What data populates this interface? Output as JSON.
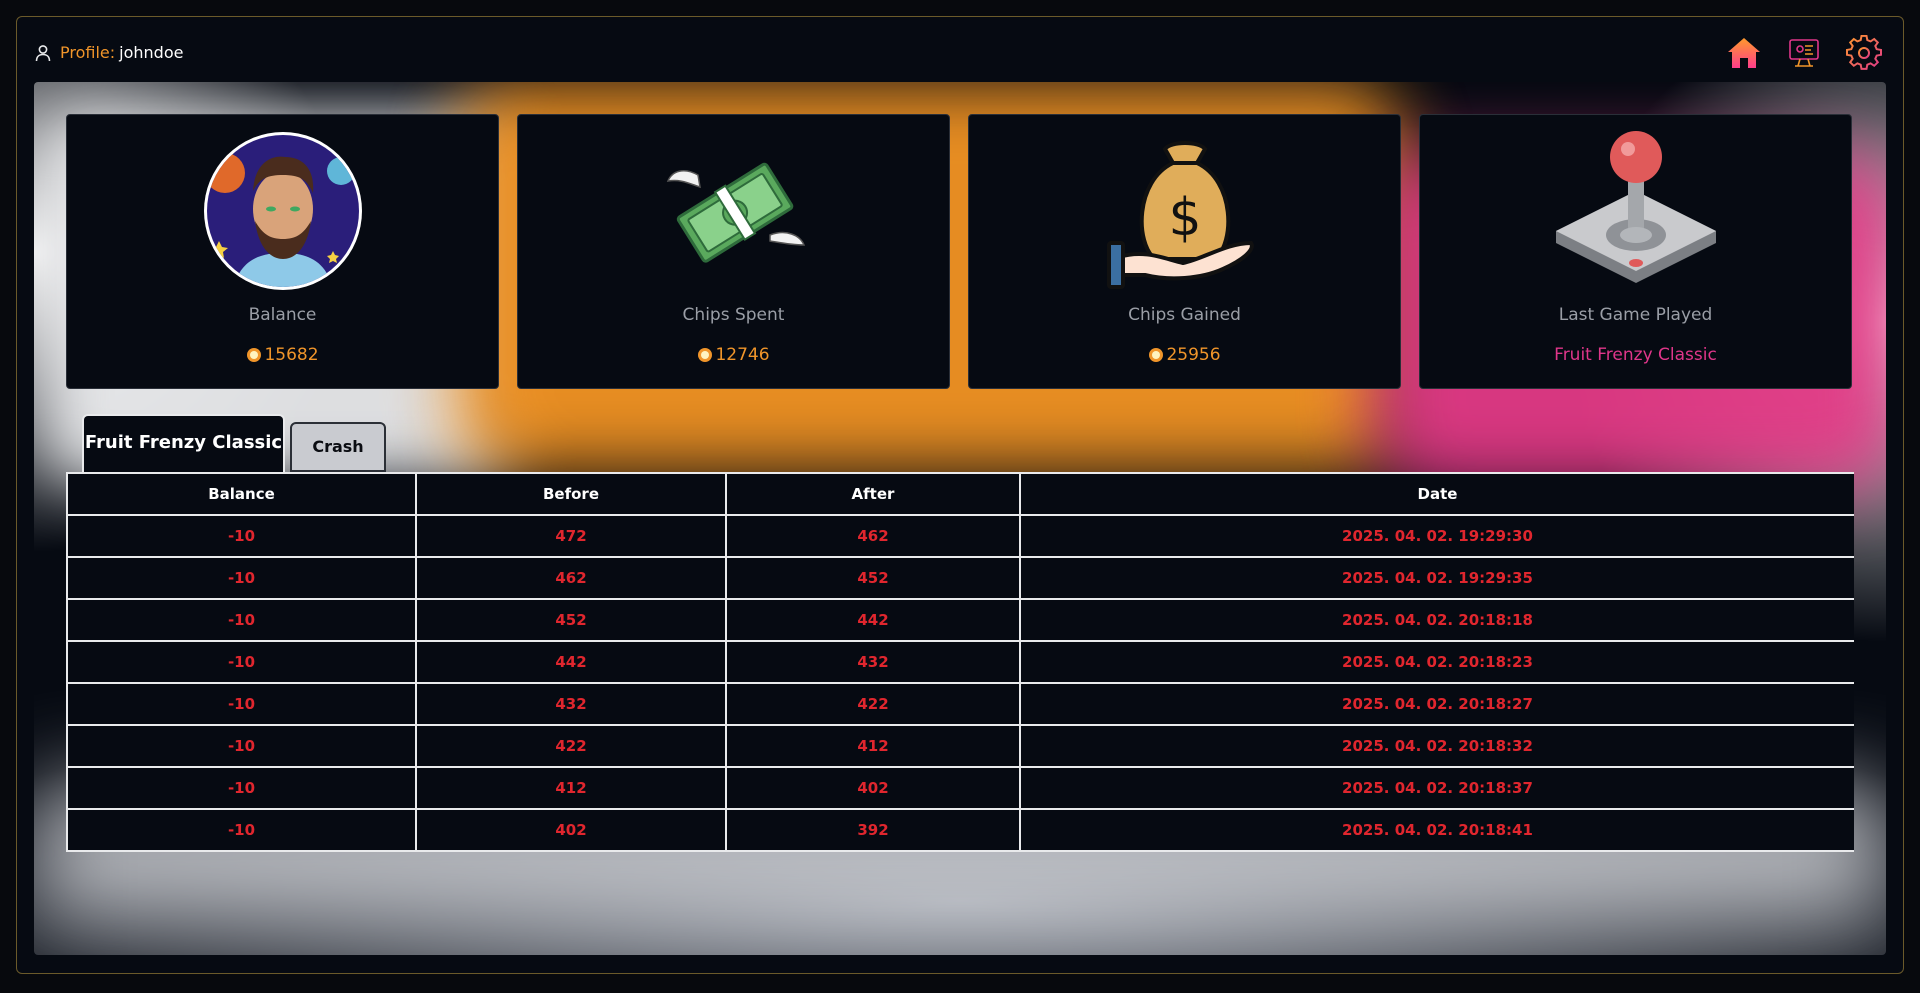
{
  "header": {
    "profile_label": "Profile:",
    "username": "johndoe",
    "icons": [
      "home-icon",
      "game-monitor-icon",
      "gear-icon"
    ]
  },
  "cards": [
    {
      "caption": "Balance",
      "value": "15682",
      "art": "avatar"
    },
    {
      "caption": "Chips Spent",
      "value": "12746",
      "art": "flying-money-icon"
    },
    {
      "caption": "Chips Gained",
      "value": "25956",
      "art": "money-bag-hand-icon"
    },
    {
      "caption": "Last Game Played",
      "value": "Fruit Frenzy Classic",
      "art": "joystick-icon"
    }
  ],
  "tabs": [
    {
      "label": "Fruit Frenzy Classic",
      "active": true
    },
    {
      "label": "Crash",
      "active": false
    }
  ],
  "table": {
    "headers": [
      "Balance",
      "Before",
      "After",
      "Date"
    ],
    "rows": [
      [
        "-10",
        "472",
        "462",
        "2025. 04. 02. 19:29:30"
      ],
      [
        "-10",
        "462",
        "452",
        "2025. 04. 02. 19:29:35"
      ],
      [
        "-10",
        "452",
        "442",
        "2025. 04. 02. 20:18:18"
      ],
      [
        "-10",
        "442",
        "432",
        "2025. 04. 02. 20:18:23"
      ],
      [
        "-10",
        "432",
        "422",
        "2025. 04. 02. 20:18:27"
      ],
      [
        "-10",
        "422",
        "412",
        "2025. 04. 02. 20:18:32"
      ],
      [
        "-10",
        "412",
        "402",
        "2025. 04. 02. 20:18:37"
      ],
      [
        "-10",
        "402",
        "392",
        "2025. 04. 02. 20:18:41"
      ]
    ]
  },
  "colors": {
    "accent_orange": "#f0952a",
    "accent_pink": "#e0368a",
    "negative_red": "#e0262e",
    "background": "#060a12"
  }
}
